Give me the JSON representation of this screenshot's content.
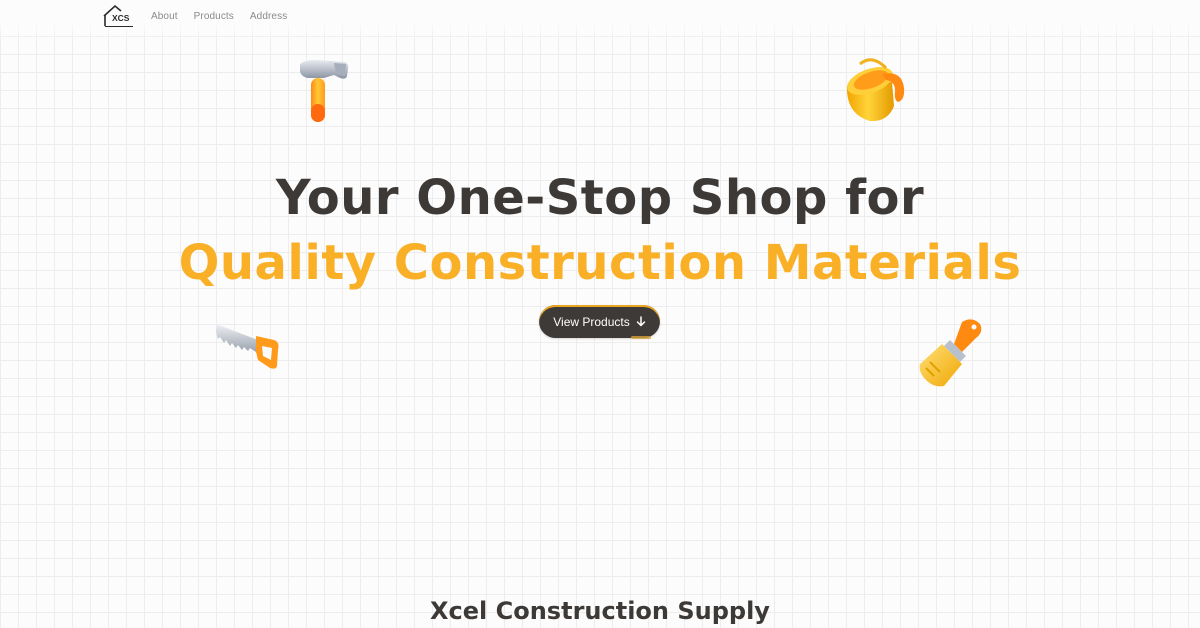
{
  "brand": {
    "logo_text": "XCS"
  },
  "nav": {
    "items": [
      {
        "label": "About"
      },
      {
        "label": "Products"
      },
      {
        "label": "Address"
      }
    ]
  },
  "hero": {
    "line1": "Your One-Stop Shop for",
    "line2": "Quality Construction Materials",
    "cta_label": "View Products"
  },
  "footer": {
    "company_name": "Xcel Construction Supply"
  },
  "icons": [
    "hammer-icon",
    "paint-bucket-icon",
    "saw-icon",
    "paint-brush-icon",
    "arrow-down-icon"
  ],
  "colors": {
    "accent": "#f9b027",
    "dark": "#3d3936",
    "background": "#fcfcfc",
    "nav_text": "#8a8a8a"
  }
}
